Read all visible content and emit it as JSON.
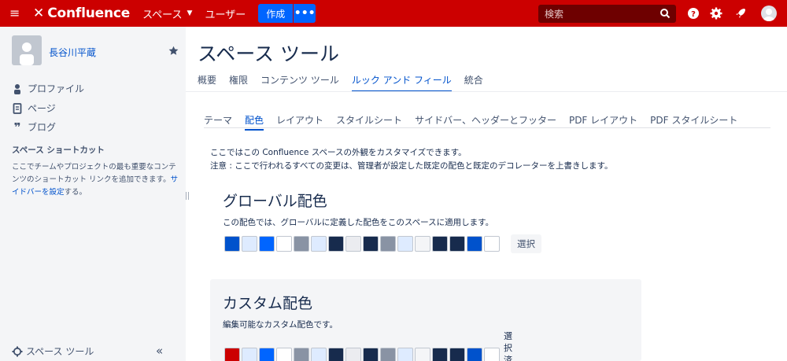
{
  "header": {
    "logo_text": "Confluence",
    "nav_spaces": "スペース",
    "nav_users": "ユーザー",
    "create_label": "作成",
    "more_label": "•••",
    "search_placeholder": "検索"
  },
  "sidebar": {
    "space_name": "長谷川平蔵",
    "links": [
      {
        "label": "プロファイル",
        "icon": "person-icon"
      },
      {
        "label": "ページ",
        "icon": "page-icon"
      },
      {
        "label": "ブログ",
        "icon": "quote-icon"
      }
    ],
    "shortcut_title": "スペース ショートカット",
    "shortcut_desc": "ここでチームやプロジェクトの最も重要なコンテンツのショートカット リンクを追加できます。",
    "shortcut_link": "サイドバーを設定",
    "shortcut_suffix": "する。",
    "space_tools": "スペース ツール",
    "collapse_label": "«"
  },
  "main": {
    "title": "スペース ツール",
    "tabs": [
      "概要",
      "権限",
      "コンテンツ ツール",
      "ルック アンド フィール",
      "統合"
    ],
    "active_tab": 3,
    "subtabs": [
      "テーマ",
      "配色",
      "レイアウト",
      "スタイルシート",
      "サイドバー、ヘッダーとフッター",
      "PDF レイアウト",
      "PDF スタイルシート"
    ],
    "active_subtab": 1,
    "intro_line1": "ここではこの Confluence スペースの外観をカスタマイズできます。",
    "intro_line2": "注意 : ここで行われるすべての変更は、管理者が設定した既定の配色と既定のデコレーターを上書きします。",
    "global_scheme": {
      "title": "グローバル配色",
      "desc": "この配色では、グローバルに定義した配色をこのスペースに適用します。",
      "select_label": "選択",
      "colors": [
        "#0052cc",
        "#deebff",
        "#0065ff",
        "#ffffff",
        "#8993a4",
        "#deebff",
        "#172b4d",
        "#ebecf0",
        "#172b4d",
        "#8993a4",
        "#deebff",
        "#f4f5f7",
        "#172b4d",
        "#172b4d",
        "#0052cc",
        "#ffffff"
      ]
    },
    "custom_scheme": {
      "title": "カスタム配色",
      "desc": "編集可能なカスタム配色です。",
      "selected_label": "選択済",
      "colors": [
        "#cc0000",
        "#deebff",
        "#0065ff",
        "#ffffff",
        "#8993a4",
        "#deebff",
        "#172b4d",
        "#ebecf0",
        "#172b4d",
        "#8993a4",
        "#deebff",
        "#f4f5f7",
        "#172b4d",
        "#172b4d",
        "#0052cc",
        "#ffffff"
      ]
    }
  },
  "colors": {
    "header_bg": "#cc0000",
    "accent": "#0052cc",
    "button": "#0065ff"
  }
}
